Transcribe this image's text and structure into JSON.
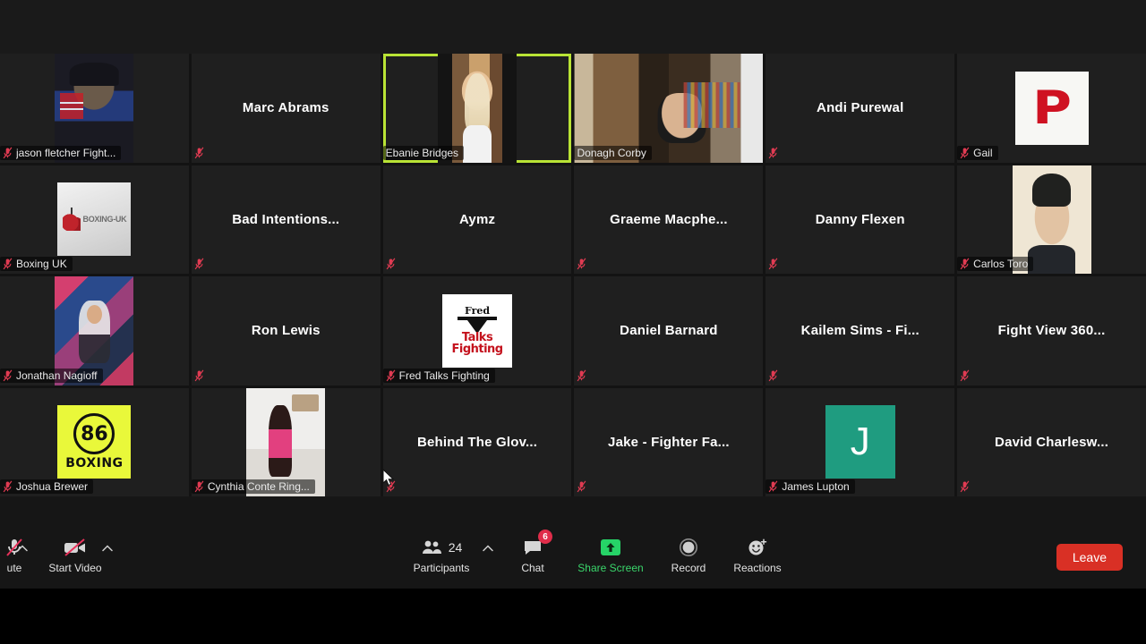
{
  "meeting": {
    "active_speaker": "Ebanie Bridges",
    "highlight_color": "#b9e335"
  },
  "gallery": {
    "tiles": [
      {
        "name": "jason fletcher Fight...",
        "layout": "video",
        "art": "ph-jason",
        "muted": true,
        "label_position": "bottom",
        "active": false
      },
      {
        "name": "Marc Abrams",
        "layout": "name-only",
        "art": "",
        "muted": true,
        "label_position": "center",
        "active": false
      },
      {
        "name": "Ebanie Bridges",
        "layout": "video",
        "art": "ph-ebanie",
        "muted": false,
        "label_position": "bottom",
        "active": true
      },
      {
        "name": "Donagh Corby",
        "layout": "video-wide",
        "art": "ph-donagh",
        "muted": false,
        "label_position": "bottom",
        "active": false
      },
      {
        "name": "Andi Purewal",
        "layout": "name-only",
        "art": "",
        "muted": true,
        "label_position": "center",
        "active": false
      },
      {
        "name": "Gail",
        "layout": "avatar",
        "art": "art-gail",
        "muted": true,
        "label_position": "bottom",
        "active": false
      },
      {
        "name": "Boxing UK",
        "layout": "avatar",
        "art": "art-boxinguk",
        "muted": true,
        "label_position": "bottom",
        "active": false
      },
      {
        "name": "Bad  Intentions...",
        "layout": "name-only",
        "art": "",
        "muted": true,
        "label_position": "center",
        "active": false
      },
      {
        "name": "Aymz",
        "layout": "name-only",
        "art": "",
        "muted": true,
        "label_position": "center",
        "active": false
      },
      {
        "name": "Graeme  Macphe...",
        "layout": "name-only",
        "art": "",
        "muted": true,
        "label_position": "center",
        "active": false
      },
      {
        "name": "Danny Flexen",
        "layout": "name-only",
        "art": "",
        "muted": true,
        "label_position": "center",
        "active": false
      },
      {
        "name": "Carlos Toro",
        "layout": "video",
        "art": "ph-carlos",
        "muted": true,
        "label_position": "bottom",
        "active": false
      },
      {
        "name": "Jonathan Nagioff",
        "layout": "video",
        "art": "ph-jonathan",
        "muted": true,
        "label_position": "bottom",
        "active": false
      },
      {
        "name": "Ron Lewis",
        "layout": "name-only",
        "art": "",
        "muted": true,
        "label_position": "center",
        "active": false
      },
      {
        "name": "Fred Talks Fighting",
        "layout": "avatar",
        "art": "art-fred",
        "muted": true,
        "label_position": "bottom",
        "active": false
      },
      {
        "name": "Daniel Barnard",
        "layout": "name-only",
        "art": "",
        "muted": true,
        "label_position": "center",
        "active": false
      },
      {
        "name": "Kailem Sims - Fi...",
        "layout": "name-only",
        "art": "",
        "muted": true,
        "label_position": "center",
        "active": false
      },
      {
        "name": "Fight View 360...",
        "layout": "name-only",
        "art": "",
        "muted": true,
        "label_position": "center",
        "active": false
      },
      {
        "name": "Joshua Brewer",
        "layout": "avatar",
        "art": "art-86",
        "muted": true,
        "label_position": "bottom",
        "active": false
      },
      {
        "name": "Cynthia Conte Ring...",
        "layout": "video",
        "art": "ph-cynthia",
        "muted": true,
        "label_position": "bottom",
        "active": false
      },
      {
        "name": "Behind The Glov...",
        "layout": "name-only",
        "art": "",
        "muted": true,
        "label_position": "center",
        "active": false
      },
      {
        "name": "Jake - Fighter Fa...",
        "layout": "name-only",
        "art": "",
        "muted": true,
        "label_position": "center",
        "active": false
      },
      {
        "name": "James Lupton",
        "layout": "avatar",
        "art": "art-letter",
        "avatar_letter": "J",
        "muted": true,
        "label_position": "bottom",
        "active": false
      },
      {
        "name": "David  Charlesw...",
        "layout": "name-only",
        "art": "",
        "muted": true,
        "label_position": "center",
        "active": false
      }
    ]
  },
  "toolbar": {
    "unmute_label": "ute",
    "start_video_label": "Start Video",
    "participants_label": "Participants",
    "participants_count": "24",
    "chat_label": "Chat",
    "chat_badge": "6",
    "share_screen_label": "Share Screen",
    "record_label": "Record",
    "reactions_label": "Reactions",
    "leave_label": "Leave"
  }
}
